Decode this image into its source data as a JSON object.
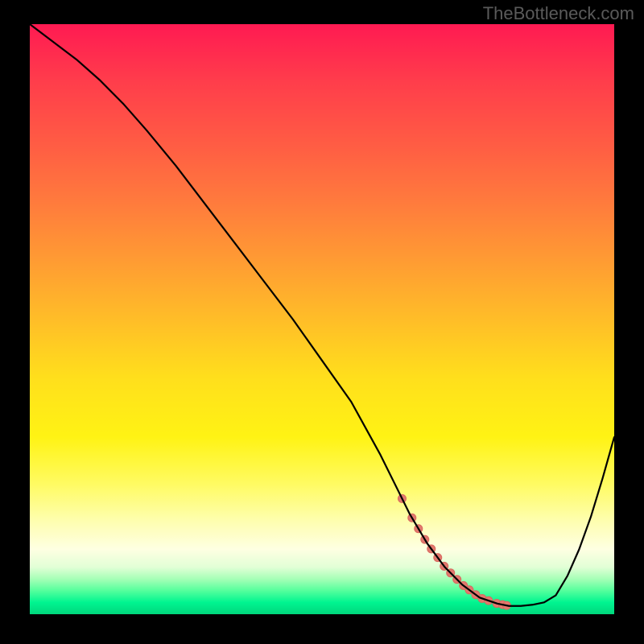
{
  "watermark": "TheBottleneck.com",
  "chart_data": {
    "type": "line",
    "title": "",
    "xlabel": "",
    "ylabel": "",
    "xlim": [
      0,
      100
    ],
    "ylim": [
      0,
      100
    ],
    "series": [
      {
        "name": "curve",
        "x": [
          0,
          4,
          8,
          12,
          16,
          20,
          25,
          30,
          35,
          40,
          45,
          50,
          55,
          60,
          63,
          65,
          68,
          71,
          74,
          77,
          80,
          82,
          84,
          86,
          88,
          90,
          92,
          94,
          96,
          98,
          100
        ],
        "y": [
          100,
          97,
          94,
          90.5,
          86.5,
          82,
          76,
          69.5,
          63,
          56.5,
          50,
          43,
          36,
          27,
          21,
          17,
          12,
          8,
          5,
          2.8,
          1.8,
          1.4,
          1.4,
          1.6,
          2,
          3.2,
          6.5,
          11,
          16.5,
          23,
          30
        ]
      }
    ],
    "bumps": {
      "comment": "decorative dot cluster near trough",
      "x": [
        63.7,
        65.4,
        66.5,
        67.6,
        68.7,
        69.8,
        70.9,
        72.0,
        73.1,
        74.2,
        75.2,
        76.3,
        77.4,
        78.5,
        79.9,
        80.9,
        81.6
      ],
      "radius": 5
    },
    "colors": {
      "curve": "#000000",
      "bumps": "#e2786e",
      "background_top": "#ff1a52",
      "background_bottom": "#00d77c"
    }
  }
}
